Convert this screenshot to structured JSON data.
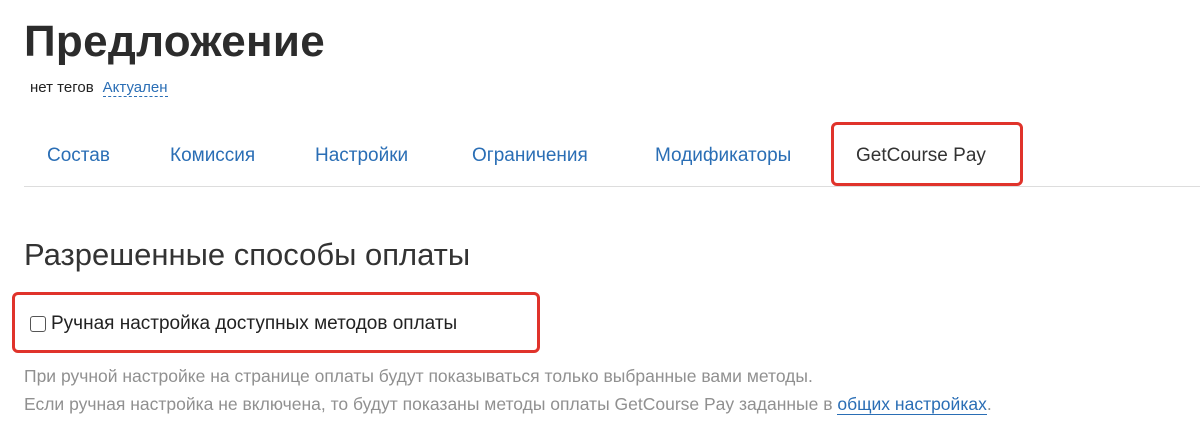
{
  "page": {
    "title": "Предложение"
  },
  "tags": {
    "no_tags": "нет тегов",
    "status": "Актуален"
  },
  "tabs": [
    {
      "label": "Состав",
      "active": false
    },
    {
      "label": "Комиссия",
      "active": false
    },
    {
      "label": "Настройки",
      "active": false
    },
    {
      "label": "Ограничения",
      "active": false
    },
    {
      "label": "Модификаторы",
      "active": false
    },
    {
      "label": "GetCourse Pay",
      "active": true
    }
  ],
  "payment_methods": {
    "section_title": "Разрешенные способы оплаты",
    "manual_checkbox": {
      "label": "Ручная настройка доступных методов оплаты",
      "checked": false
    },
    "help_line_1": "При ручной настройке на странице оплаты будут показываться только выбранные вами методы.",
    "help_line_2_prefix": "Если ручная настройка не включена, то будут показаны методы оплаты GetCourse Pay заданные в ",
    "help_link": "общих настройках",
    "help_line_2_suffix": "."
  },
  "colors": {
    "link": "#2a6eb5",
    "highlight": "#e0332b",
    "muted_text": "#909090"
  }
}
